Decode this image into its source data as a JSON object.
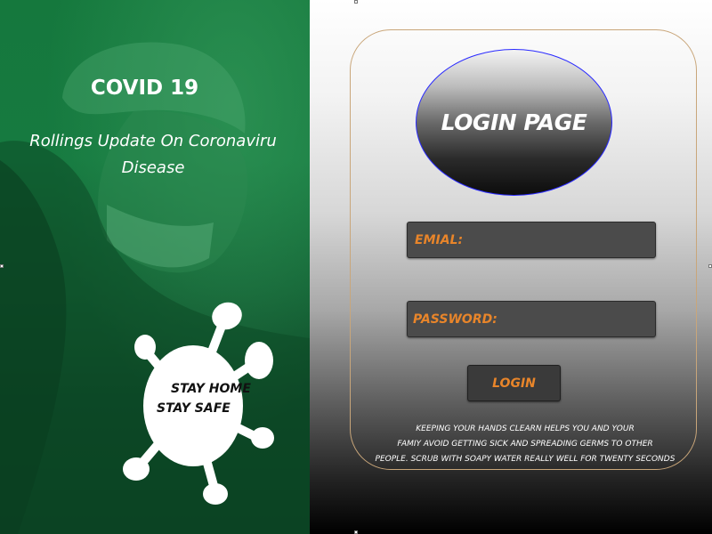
{
  "left_panel": {
    "title": "COVID 19",
    "subtitle": "Rollings Update On Coronaviru Disease",
    "badge": {
      "line1": "STAY HOME",
      "line2": "STAY SAFE",
      "icon": "virus-icon"
    },
    "colors": {
      "background": "#137a3c"
    }
  },
  "right_panel": {
    "heading": "LOGIN PAGE",
    "email_label": "EMIAL:",
    "password_label": "PASSWORD:",
    "login_button": "LOGIN",
    "tip_lines": [
      "KEEPING YOUR HANDS CLEARN HELPS YOU AND YOUR",
      "FAMIY AVOID GETTING SICK AND SPREADING GERMS TO OTHER",
      "PEOPLE. SCRUB WITH SOAPY WATER REALLY WELL FOR TWENTY SECONDS"
    ],
    "colors": {
      "accent": "#e8852a",
      "field": "#4b4b4b",
      "oval_border": "#2a2aff",
      "card_border": "#c9a67a"
    }
  }
}
